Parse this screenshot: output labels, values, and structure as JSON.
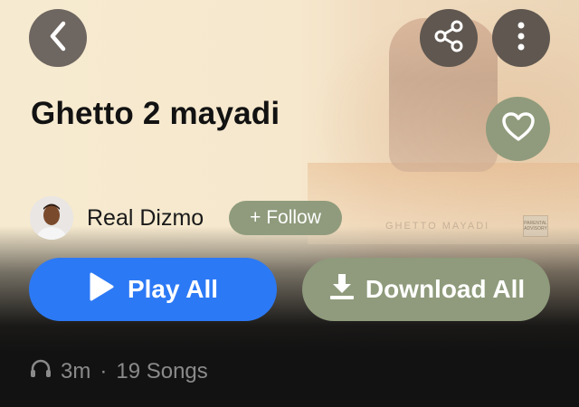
{
  "album": {
    "title": "Ghetto 2 mayadi",
    "artwork_caption": "GHETTO MAYADI"
  },
  "artist": {
    "name": "Real Dizmo",
    "follow_label": "+ Follow"
  },
  "actions": {
    "play_all_label": "Play All",
    "download_all_label": "Download All"
  },
  "stats": {
    "listens": "3m",
    "separator": "·",
    "song_count": "19 Songs"
  },
  "icons": {
    "back": "chevron-left-icon",
    "share": "share-icon",
    "more": "more-vertical-icon",
    "like": "heart-icon",
    "play": "play-icon",
    "download": "download-icon",
    "headphones": "headphones-icon"
  },
  "colors": {
    "play_button": "#2c79f5",
    "accent_olive": "#8f9b7c",
    "dark_background": "#121212",
    "hero_background": "#f4e6cb"
  }
}
